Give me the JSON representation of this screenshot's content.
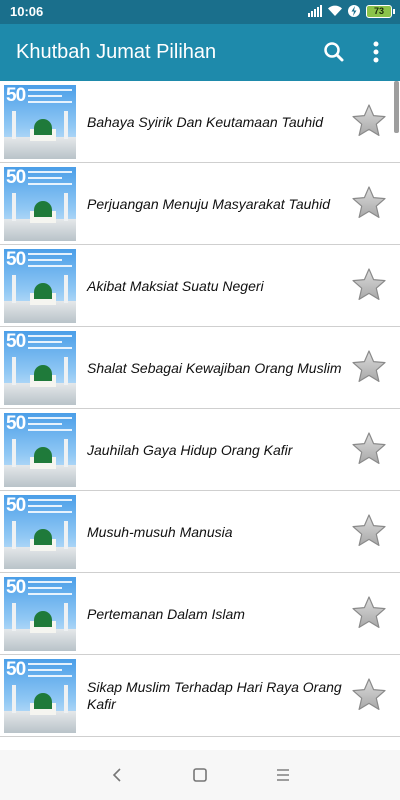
{
  "status_bar": {
    "time": "10:06",
    "battery": "73"
  },
  "app_bar": {
    "title": "Khutbah Jumat Pilihan",
    "search_icon": "search-icon",
    "more_icon": "more-vert-icon"
  },
  "thumbnail": {
    "number": "50"
  },
  "items": [
    {
      "title": "Bahaya Syirik Dan Keutamaan Tauhid"
    },
    {
      "title": "Perjuangan Menuju Masyarakat Tauhid"
    },
    {
      "title": "Akibat Maksiat Suatu Negeri"
    },
    {
      "title": "Shalat Sebagai Kewajiban Orang Muslim"
    },
    {
      "title": "Jauhilah Gaya Hidup Orang Kafir"
    },
    {
      "title": "Musuh-musuh Manusia"
    },
    {
      "title": "Pertemanan Dalam Islam"
    },
    {
      "title": "Sikap Muslim Terhadap Hari Raya Orang Kafir"
    }
  ],
  "colors": {
    "app_bar": "#1e8aab",
    "status_bar": "#1a6f8c",
    "star": "#c8c8c8"
  },
  "nav_bar": {
    "back_icon": "back-icon",
    "home_icon": "home-icon",
    "recents_icon": "recents-icon"
  }
}
